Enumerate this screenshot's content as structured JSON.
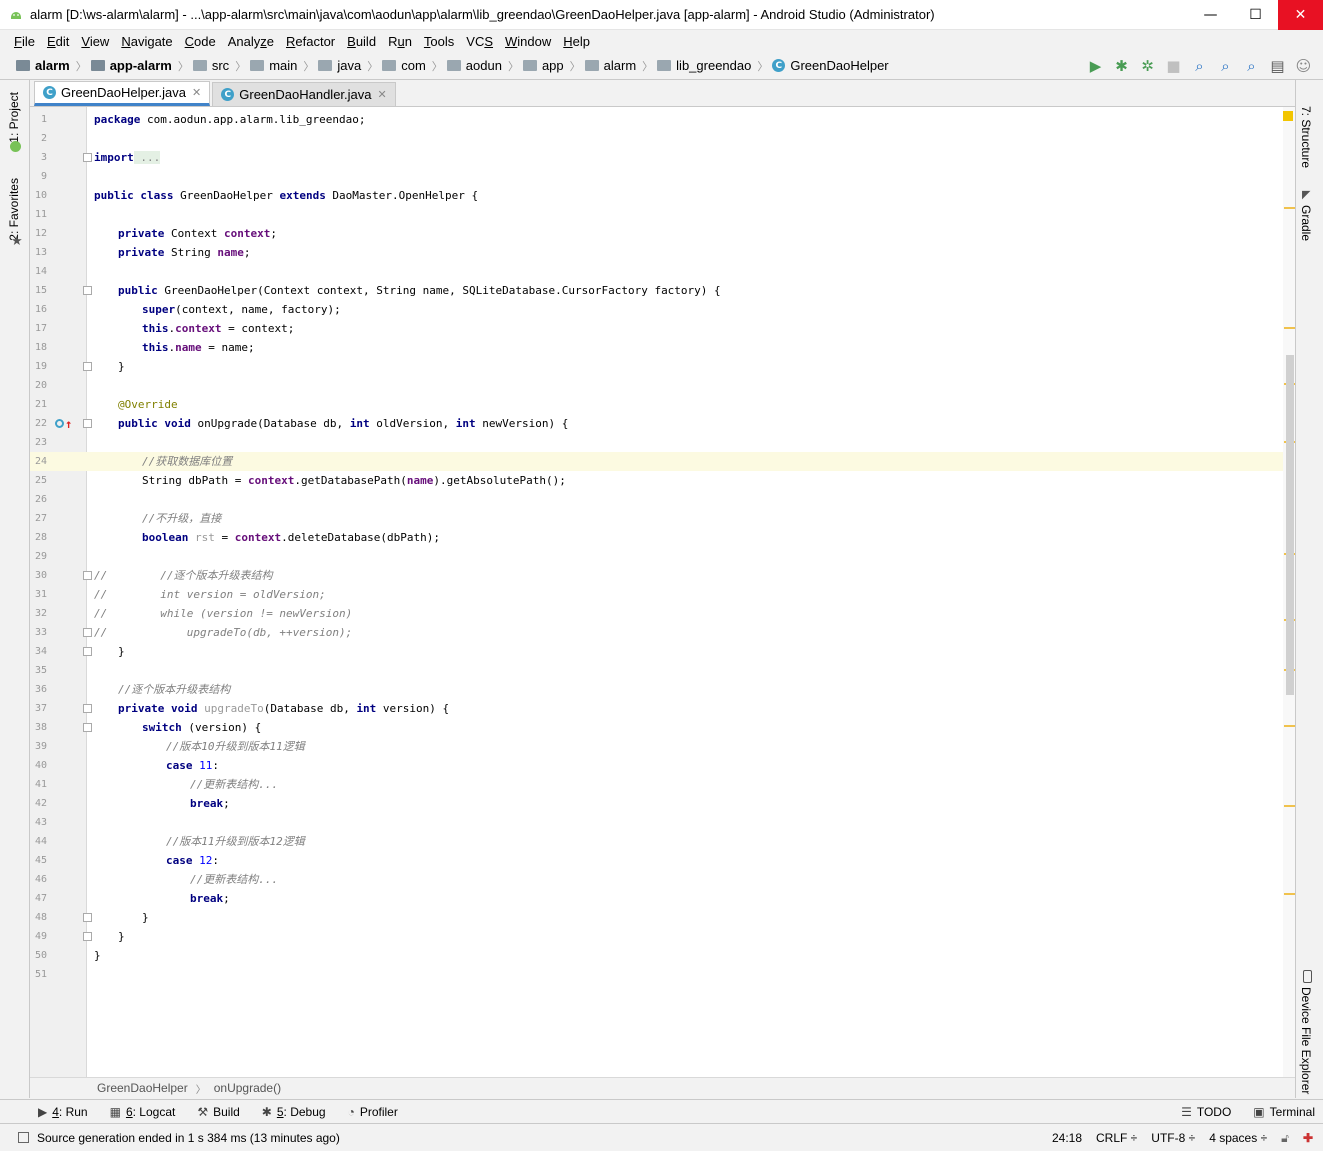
{
  "window": {
    "title": "alarm [D:\\ws-alarm\\alarm] - ...\\app-alarm\\src\\main\\java\\com\\aodun\\app\\alarm\\lib_greendao\\GreenDaoHelper.java [app-alarm] - Android Studio (Administrator)",
    "minimize": "—",
    "maximize": "☐",
    "close": "✕"
  },
  "menu": [
    {
      "mn": "F",
      "rest": "ile"
    },
    {
      "mn": "E",
      "rest": "dit"
    },
    {
      "mn": "V",
      "rest": "iew"
    },
    {
      "mn": "N",
      "rest": "avigate"
    },
    {
      "mn": "C",
      "rest": "ode"
    },
    {
      "mn": "",
      "rest": "Analy",
      "mn2": "z",
      "rest2": "e"
    },
    {
      "mn": "R",
      "rest": "efactor"
    },
    {
      "mn": "B",
      "rest": "uild"
    },
    {
      "mn": "",
      "rest": "R",
      "mn2": "u",
      "rest2": "n"
    },
    {
      "mn": "T",
      "rest": "ools"
    },
    {
      "mn": "",
      "rest": "VC",
      "mn2": "S",
      "rest2": ""
    },
    {
      "mn": "W",
      "rest": "indow"
    },
    {
      "mn": "H",
      "rest": "elp"
    }
  ],
  "breadcrumbs": [
    "alarm",
    "app-alarm",
    "src",
    "main",
    "java",
    "com",
    "aodun",
    "app",
    "alarm",
    "lib_greendao",
    "GreenDaoHelper"
  ],
  "tabs": [
    {
      "label": "GreenDaoHelper.java",
      "icon": "C"
    },
    {
      "label": "GreenDaoHandler.java",
      "icon": "C"
    }
  ],
  "left_strip": {
    "project": "1: Project",
    "favorites": "2: Favorites"
  },
  "right_strip": {
    "structure": "7: Structure",
    "gradle": "Gradle",
    "device": "Device File Explorer"
  },
  "line_numbers": [
    "1",
    "2",
    "3",
    "9",
    "10",
    "11",
    "12",
    "13",
    "14",
    "15",
    "16",
    "17",
    "18",
    "19",
    "20",
    "21",
    "22",
    "23",
    "24",
    "25",
    "26",
    "27",
    "28",
    "29",
    "30",
    "31",
    "32",
    "33",
    "34",
    "35",
    "36",
    "37",
    "38",
    "39",
    "40",
    "41",
    "42",
    "43",
    "44",
    "45",
    "46",
    "47",
    "48",
    "49",
    "50",
    "51"
  ],
  "code": {
    "l1_kw": "package",
    "l1_rest": " com.aodun.app.alarm.lib_greendao;",
    "l3_kw": "import",
    "l3_ph": " ...",
    "l10_a": "public class",
    "l10_b": " GreenDaoHelper ",
    "l10_c": "extends",
    "l10_d": " DaoMaster.OpenHelper {",
    "l12_a": "private",
    "l12_b": " Context ",
    "l12_c": "context",
    "l12_d": ";",
    "l13_a": "private",
    "l13_b": " String ",
    "l13_c": "name",
    "l13_d": ";",
    "l15_a": "public",
    "l15_b": " GreenDaoHelper(Context context, String name, SQLiteDatabase.CursorFactory factory) {",
    "l16_a": "super",
    "l16_b": "(context, name, factory);",
    "l17_a": "this",
    "l17_b": ".",
    "l17_c": "context",
    "l17_d": " = context;",
    "l18_a": "this",
    "l18_b": ".",
    "l18_c": "name",
    "l18_d": " = name;",
    "l19": "}",
    "l21": "@Override",
    "l22_a": "public void",
    "l22_b": " onUpgrade(Database db, ",
    "l22_c": "int",
    "l22_d": " oldVersion, ",
    "l22_e": "int",
    "l22_f": " newVersion) {",
    "l24": "//获取数据库位置",
    "l25_a": "String dbPath = ",
    "l25_b": "context",
    "l25_c": ".getDatabasePath(",
    "l25_d": "name",
    "l25_e": ").getAbsolutePath();",
    "l27": "//不升级，直接",
    "l28_a": "boolean",
    "l28_b": " rst",
    "l28_c": " = ",
    "l28_d": "context",
    "l28_e": ".deleteDatabase(dbPath);",
    "l30_a": "//",
    "l30_b": "        //逐个版本升级表结构",
    "l31_a": "//",
    "l31_b": "        int version = oldVersion;",
    "l32_a": "//",
    "l32_b": "        while (version != newVersion)",
    "l33_a": "//",
    "l33_b": "            upgradeTo(db, ++version);",
    "l34": "}",
    "l36": "//逐个版本升级表结构",
    "l37_a": "private void",
    "l37_b": " upgradeTo",
    "l37_c": "(Database db, ",
    "l37_d": "int",
    "l37_e": " version) {",
    "l38_a": "switch",
    "l38_b": " (version) {",
    "l39": "//版本10升级到版本11逻辑",
    "l40_a": "case",
    "l40_b": " 11",
    "l40_c": ":",
    "l41": "//更新表结构...",
    "l42_a": "break",
    "l42_b": ";",
    "l44": "//版本11升级到版本12逻辑",
    "l45_a": "case",
    "l45_b": " 12",
    "l45_c": ":",
    "l46": "//更新表结构...",
    "l47_a": "break",
    "l47_b": ";",
    "l48": "}",
    "l49": "}",
    "l50": "}"
  },
  "editor_breadcrumb": [
    "GreenDaoHelper",
    "onUpgrade()"
  ],
  "tool_windows": [
    {
      "icon": "▶",
      "num": "4",
      "label": ": Run"
    },
    {
      "icon": "▦",
      "num": "6",
      "label": ": Logcat"
    },
    {
      "icon": "⚒",
      "num": "",
      "label": "Build"
    },
    {
      "icon": "✱",
      "num": "5",
      "label": ": Debug"
    },
    {
      "icon": "◔",
      "num": "",
      "label": "Profiler"
    }
  ],
  "tool_windows_right": [
    "TODO",
    "Terminal"
  ],
  "status": {
    "message": "Source generation ended in 1 s 384 ms (13 minutes ago)",
    "position": "24:18",
    "line_sep": "CRLF ÷",
    "encoding": "UTF-8 ÷",
    "indent": "4 spaces ÷"
  },
  "colors": {
    "keyword": "#000080",
    "field": "#660e7a",
    "comment": "#808080",
    "annotation": "#808000",
    "number": "#0000ff",
    "tab_accent": "#4083c9",
    "current_line": "#fcfae1"
  }
}
